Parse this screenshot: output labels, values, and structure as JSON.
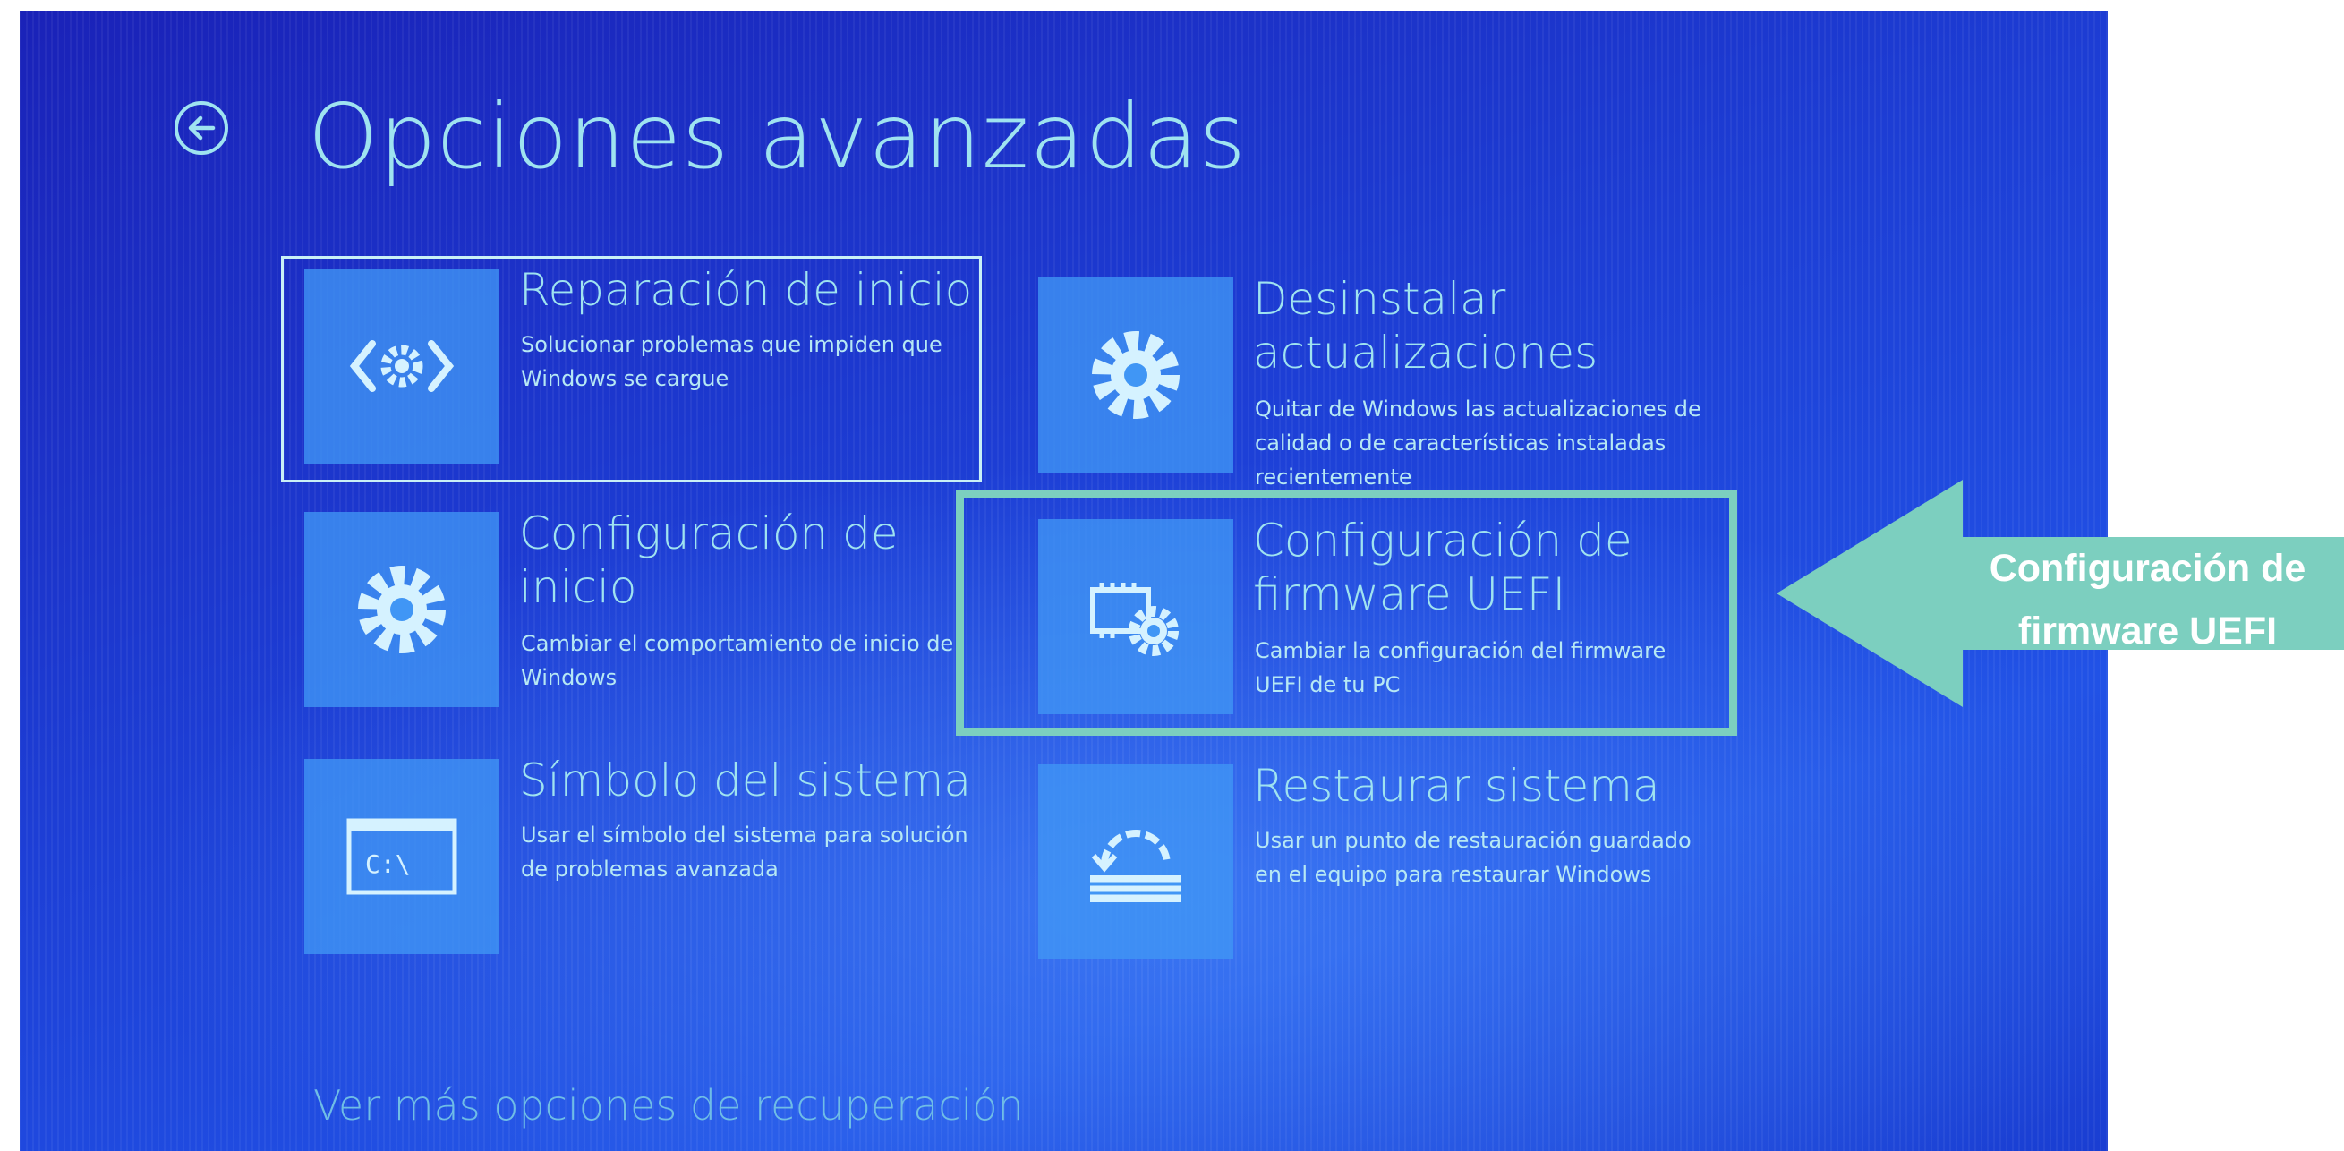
{
  "page": {
    "title": "Opciones avanzadas"
  },
  "options": [
    {
      "title": "Reparación de inicio",
      "description": "Solucionar problemas que impiden que Windows se cargue",
      "icon": "startup-repair-icon"
    },
    {
      "title": "Desinstalar actualizaciones",
      "description": "Quitar de Windows las actualizaciones de calidad o de características instaladas recientemente",
      "icon": "gear-icon"
    },
    {
      "title": "Configuración de inicio",
      "description": "Cambiar el comportamiento de inicio de Windows",
      "icon": "gear-icon"
    },
    {
      "title": "Configuración de firmware UEFI",
      "description": "Cambiar la configuración del firmware UEFI de tu PC",
      "icon": "firmware-chip-gear-icon"
    },
    {
      "title": "Símbolo del sistema",
      "description": "Usar el símbolo del sistema para solución de problemas avanzada",
      "icon": "command-prompt-icon",
      "icon_text": "C:\\"
    },
    {
      "title": "Restaurar sistema",
      "description": "Usar un punto de restauración guardado en el equipo para restaurar Windows",
      "icon": "system-restore-icon"
    }
  ],
  "more_options_link": "Ver más opciones de recuperación",
  "annotation": {
    "label": "Configuración de firmware UEFI",
    "color": "#7ccfbf",
    "text_color": "#ffffff"
  },
  "colors": {
    "screen_blue": "#1d3fd6",
    "tile_blue": "#4096f5",
    "text_cyan": "#9fe3f0"
  }
}
